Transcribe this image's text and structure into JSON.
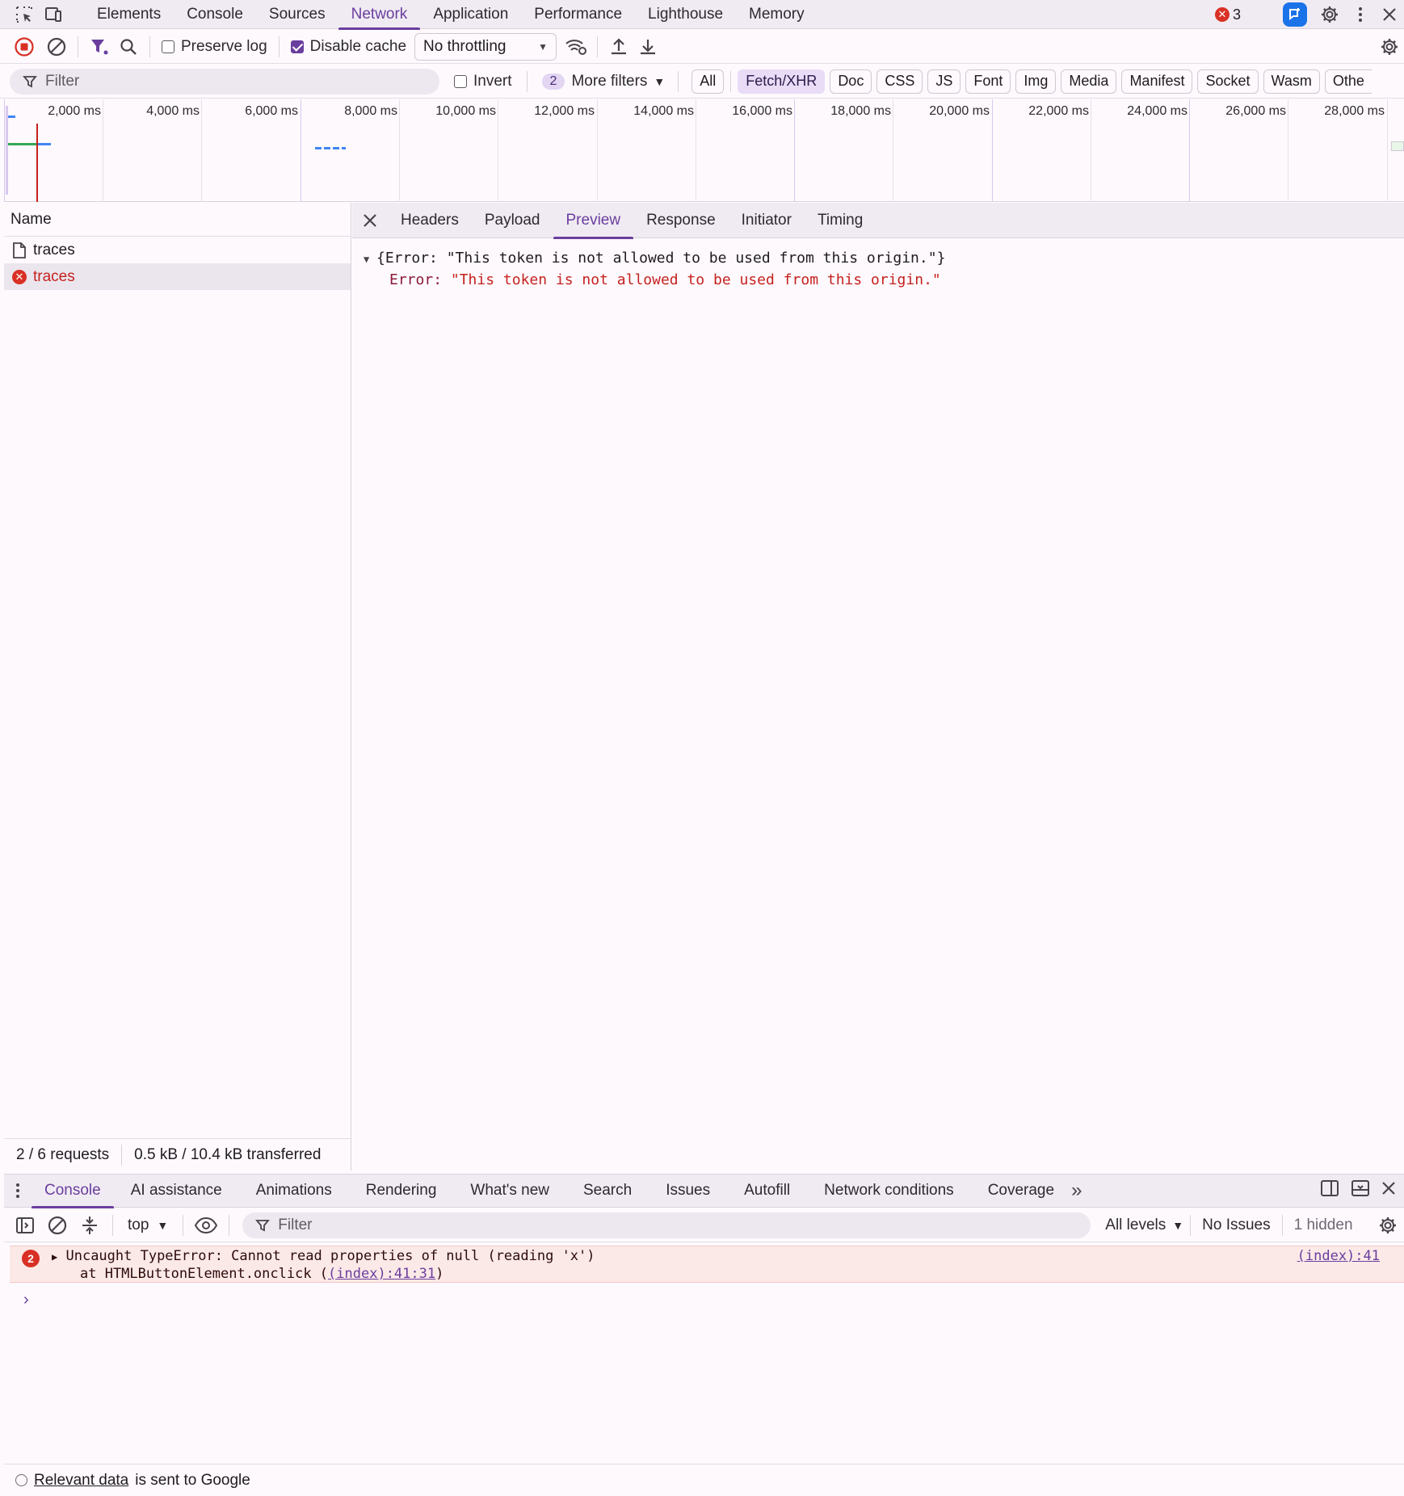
{
  "topbar": {
    "tabs": [
      "Elements",
      "Console",
      "Sources",
      "Network",
      "Application",
      "Performance",
      "Lighthouse",
      "Memory"
    ],
    "active_tab": "Network",
    "error_count": "3"
  },
  "toolbar": {
    "preserve_log": "Preserve log",
    "disable_cache": "Disable cache",
    "throttling": "No throttling"
  },
  "filterbar": {
    "filter_placeholder": "Filter",
    "invert": "Invert",
    "more_filters_count": "2",
    "more_filters": "More filters",
    "types": [
      "All",
      "Fetch/XHR",
      "Doc",
      "CSS",
      "JS",
      "Font",
      "Img",
      "Media",
      "Manifest",
      "Socket",
      "Wasm",
      "Othe"
    ],
    "active_type": "Fetch/XHR"
  },
  "overview": {
    "ticks": [
      "2,000 ms",
      "4,000 ms",
      "6,000 ms",
      "8,000 ms",
      "10,000 ms",
      "12,000 ms",
      "14,000 ms",
      "16,000 ms",
      "18,000 ms",
      "20,000 ms",
      "22,000 ms",
      "24,000 ms",
      "26,000 ms",
      "28,000 ms"
    ]
  },
  "requests": {
    "header": "Name",
    "rows": [
      {
        "name": "traces",
        "status": "ok"
      },
      {
        "name": "traces",
        "status": "error"
      }
    ],
    "summary_count": "2 / 6 requests",
    "summary_size": "0.5 kB / 10.4 kB transferred"
  },
  "details": {
    "tabs": [
      "Headers",
      "Payload",
      "Preview",
      "Response",
      "Initiator",
      "Timing"
    ],
    "active_tab": "Preview",
    "preview_line1": "{Error: \"This token is not allowed to be used from this origin.\"}",
    "preview_key": "Error",
    "preview_value": "\"This token is not allowed to be used from this origin.\""
  },
  "drawer": {
    "tabs": [
      "Console",
      "AI assistance",
      "Animations",
      "Rendering",
      "What's new",
      "Search",
      "Issues",
      "Autofill",
      "Network conditions",
      "Coverage"
    ],
    "active_tab": "Console",
    "context": "top",
    "filter_placeholder": "Filter",
    "levels": "All levels",
    "issues": "No Issues",
    "hidden": "1 hidden"
  },
  "console": {
    "error_count": "2",
    "message": "Uncaught TypeError: Cannot read properties of null (reading 'x')",
    "stack_prefix": "at HTMLButtonElement.onclick (",
    "stack_link": "(index):41:31",
    "stack_suffix": ")",
    "source": "(index):41"
  },
  "footer": {
    "link": "Relevant data",
    "text": "is sent to Google"
  }
}
